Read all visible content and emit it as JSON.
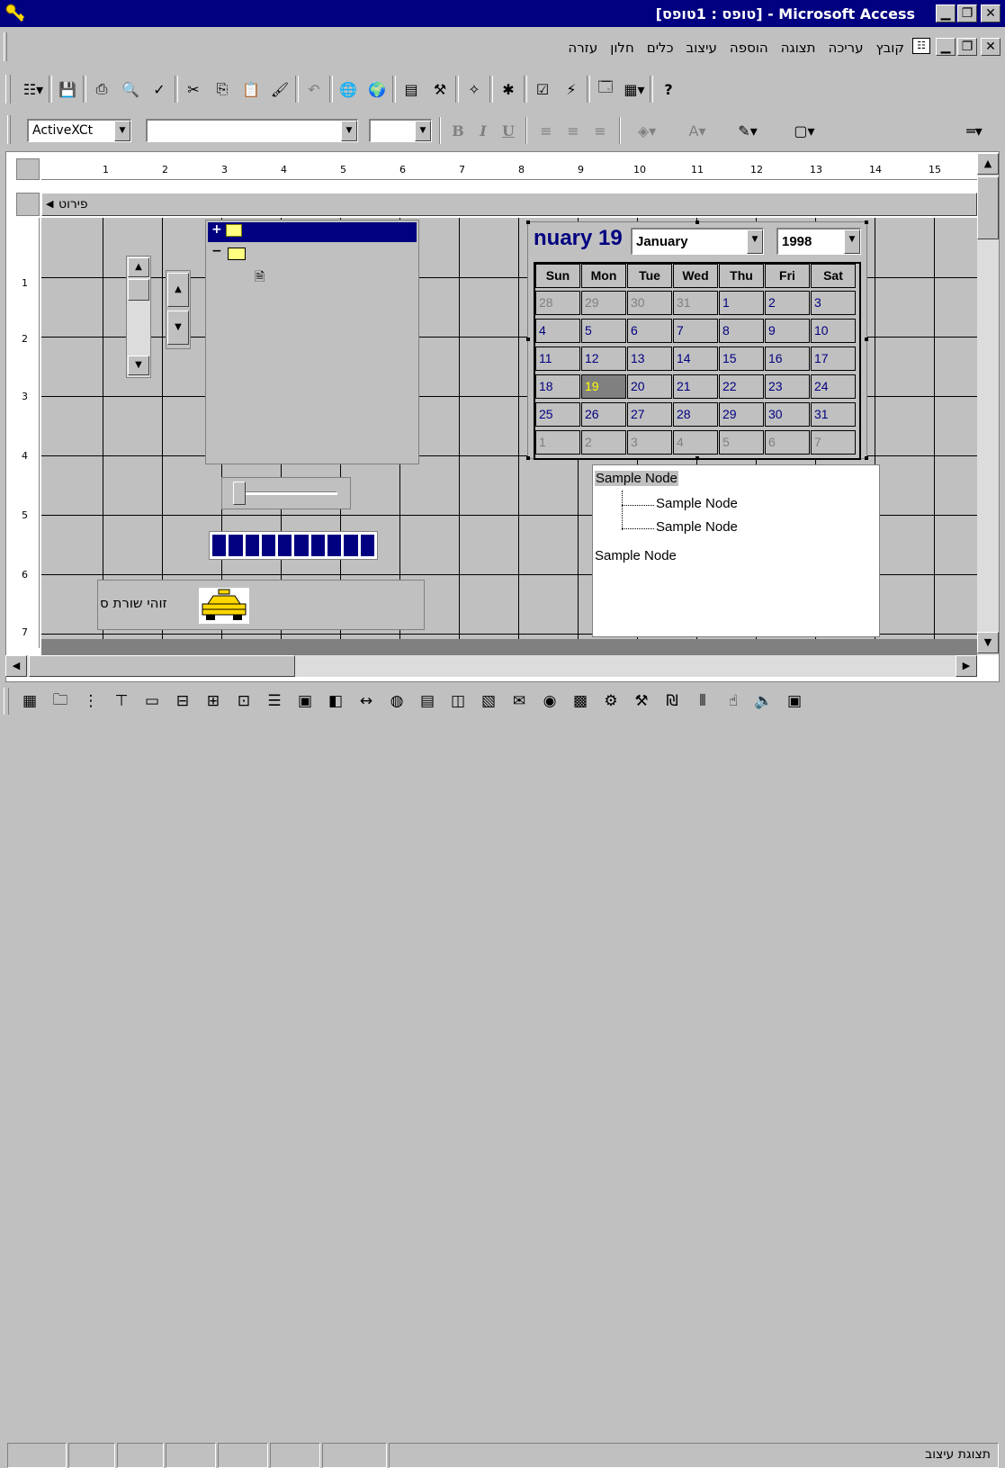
{
  "window": {
    "title": "[טופס : 1טופס] - Microsoft Access"
  },
  "menu": {
    "items": [
      "קובץ",
      "עריכה",
      "תצוגה",
      "הוספה",
      "עיצוב",
      "כלים",
      "חלון",
      "עזרה"
    ]
  },
  "format_toolbar": {
    "object_combo": "ActiveXCt",
    "font_combo": "",
    "size_combo": "",
    "bold": "B",
    "italic": "I",
    "underline": "U"
  },
  "ruler": {
    "numbers": [
      "1",
      "2",
      "3",
      "4",
      "5",
      "6",
      "7",
      "8",
      "9",
      "10",
      "11",
      "12",
      "13",
      "14",
      "15"
    ],
    "vertical_numbers": [
      "1",
      "2",
      "3",
      "4",
      "5",
      "6",
      "7"
    ]
  },
  "section": {
    "label": "פירוט"
  },
  "calendar": {
    "title": "nuary 19",
    "month": "January",
    "year": "1998",
    "days": [
      "Sun",
      "Mon",
      "Tue",
      "Wed",
      "Thu",
      "Fri",
      "Sat"
    ],
    "weeks": [
      [
        "28",
        "29",
        "30",
        "31",
        "1",
        "2",
        "3"
      ],
      [
        "4",
        "5",
        "6",
        "7",
        "8",
        "9",
        "10"
      ],
      [
        "11",
        "12",
        "13",
        "14",
        "15",
        "16",
        "17"
      ],
      [
        "18",
        "19",
        "20",
        "21",
        "22",
        "23",
        "24"
      ],
      [
        "25",
        "26",
        "27",
        "28",
        "29",
        "30",
        "31"
      ],
      [
        "1",
        "2",
        "3",
        "4",
        "5",
        "6",
        "7"
      ]
    ],
    "selected": "19"
  },
  "treeview": {
    "nodes": [
      "Sample Node",
      "Sample Node",
      "Sample Node",
      "Sample Node"
    ]
  },
  "label_control": {
    "text": "זוהי שורת ס"
  },
  "progress": {
    "segments": 10
  },
  "status_bar": {
    "text": "תצוגת עיצוב"
  },
  "colors": {
    "title_bg": "#000080",
    "selection": "#000080",
    "calendar_text": "#000080",
    "selected_day": "#ffff00"
  }
}
